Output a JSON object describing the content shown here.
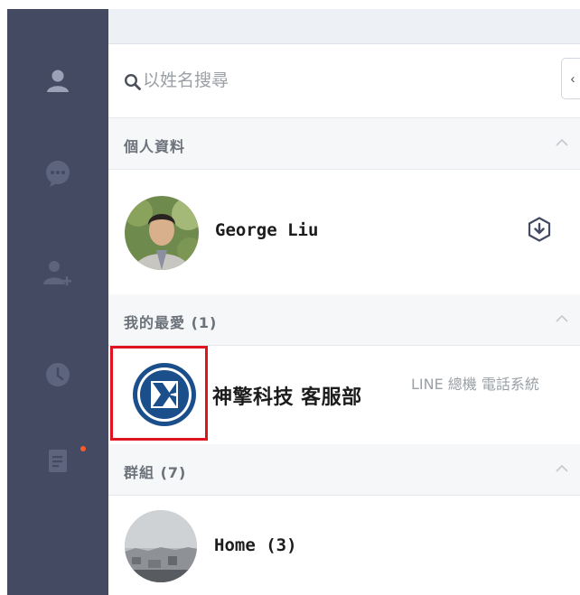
{
  "search": {
    "placeholder": "以姓名搜尋"
  },
  "sidebar": {
    "items": [
      {
        "icon": "friends-icon"
      },
      {
        "icon": "chat-icon"
      },
      {
        "icon": "add-friend-icon"
      },
      {
        "icon": "clock-icon"
      },
      {
        "icon": "notes-icon",
        "has_badge": true
      }
    ]
  },
  "sections": {
    "profile": {
      "title": "個人資料",
      "user": {
        "name": "George Liu"
      }
    },
    "favorites": {
      "title": "我的最愛 (1)",
      "contact": {
        "name": "神擎科技 客服部",
        "status": "LINE 總機 電話系統"
      }
    },
    "groups": {
      "title": "群組 (7)",
      "group": {
        "name": "Home (3)"
      }
    }
  },
  "colors": {
    "rail": "#434a62",
    "highlight": "#e0141e",
    "badge": "#ff5a2b"
  }
}
